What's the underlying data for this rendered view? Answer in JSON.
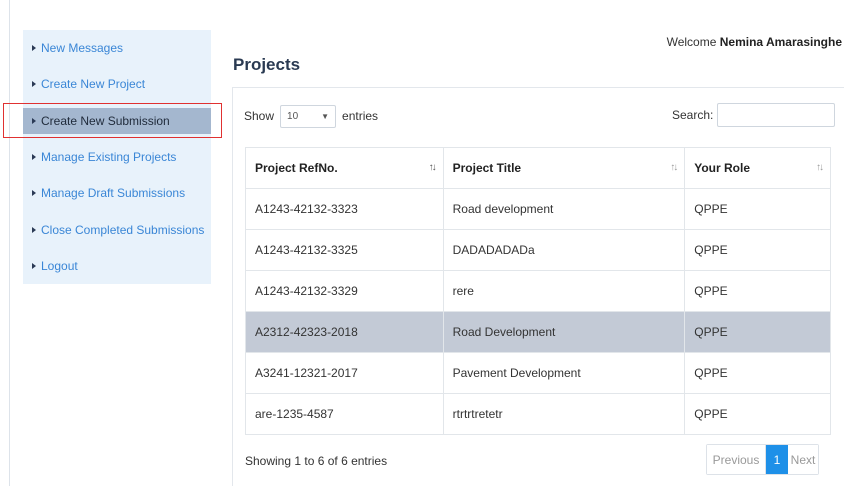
{
  "header": {
    "welcome_prefix": "Welcome ",
    "user_name": "Nemina Amarasinghe"
  },
  "sidebar": {
    "items": [
      {
        "label": "New Messages",
        "active": false
      },
      {
        "label": "Create New Project",
        "active": false
      },
      {
        "label": "Create New Submission",
        "active": true
      },
      {
        "label": "Manage Existing Projects",
        "active": false
      },
      {
        "label": "Manage Draft Submissions",
        "active": false
      },
      {
        "label": "Close Completed Submissions",
        "active": false
      },
      {
        "label": "Logout",
        "active": false
      }
    ]
  },
  "main": {
    "title": "Projects",
    "length": {
      "show_label": "Show",
      "value": "10",
      "entries_label": "entries"
    },
    "search": {
      "label": "Search:",
      "value": ""
    },
    "table": {
      "columns": [
        "Project RefNo.",
        "Project Title",
        "Your Role"
      ],
      "rows": [
        [
          "A1243-42132-3323",
          "Road development",
          "QPPE"
        ],
        [
          "A1243-42132-3325",
          "DADADADADa",
          "QPPE"
        ],
        [
          "A1243-42132-3329",
          "rere",
          "QPPE"
        ],
        [
          "A2312-42323-2018",
          "Road Development",
          "QPPE"
        ],
        [
          "A3241-12321-2017",
          "Pavement Development",
          "QPPE"
        ],
        [
          "are-1235-4587",
          "rtrtrtretetr",
          "QPPE"
        ]
      ],
      "selected_row": 3
    },
    "info": "Showing 1 to 6 of 6 entries",
    "pagination": {
      "previous": "Previous",
      "current": "1",
      "next": "Next"
    }
  },
  "colors": {
    "link": "#3a86d6",
    "sidebar_bg": "#e8f2fb",
    "active_bg": "#a4b7cf",
    "highlight_border": "#e03131",
    "selected_row": "#c3cad6",
    "page_active": "#1e90e8"
  }
}
